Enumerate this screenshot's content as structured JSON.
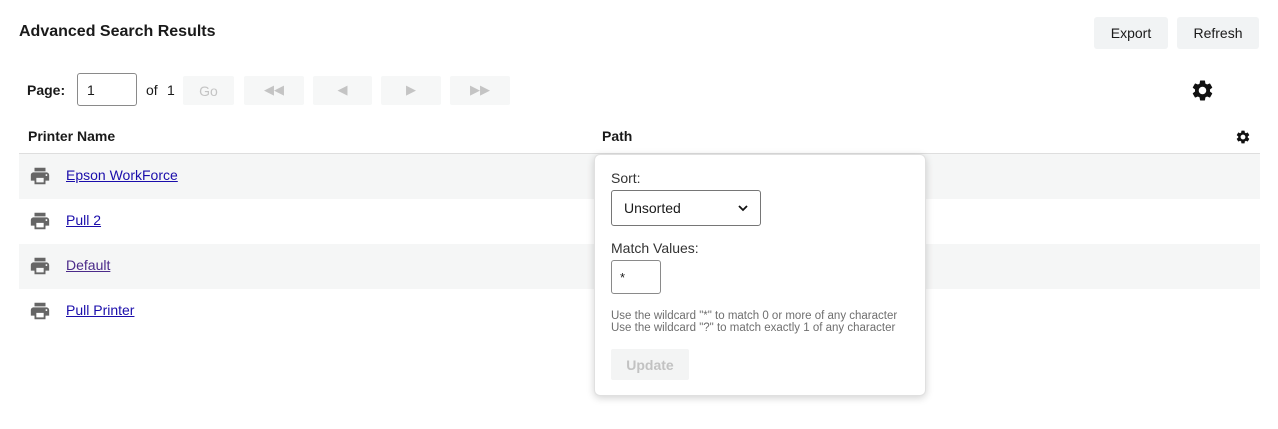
{
  "header": {
    "title": "Advanced Search Results",
    "export_label": "Export",
    "refresh_label": "Refresh"
  },
  "pagination": {
    "page_label": "Page:",
    "page_value": "1",
    "of_label": "of",
    "total_pages": "1",
    "go_label": "Go",
    "first_glyph": "◀◀",
    "prev_glyph": "◀",
    "next_glyph": "▶",
    "last_glyph": "▶▶"
  },
  "table": {
    "columns": [
      "Printer Name",
      "Path"
    ],
    "rows": [
      {
        "name": "Epson WorkForce",
        "icon": "printer-icon"
      },
      {
        "name": "Pull 2",
        "icon": "printer-icon"
      },
      {
        "name": "Default",
        "icon": "printer-icon"
      },
      {
        "name": "Pull Printer",
        "icon": "printer-icon"
      }
    ]
  },
  "filter_popover": {
    "sort_label": "Sort:",
    "sort_value": "Unsorted",
    "match_label": "Match Values:",
    "match_value": "*",
    "help_line1": "Use the wildcard \"*\" to match 0 or more of any character",
    "help_line2": "Use the wildcard \"?\" to match exactly 1 of any character",
    "update_label": "Update"
  },
  "colors": {
    "link": "#1a0dab",
    "row_alt": "#f5f6f6",
    "button_bg": "#f1f3f4",
    "icon": "#666666"
  },
  "icons": [
    "gear-icon",
    "printer-icon",
    "chevron-down-icon"
  ]
}
